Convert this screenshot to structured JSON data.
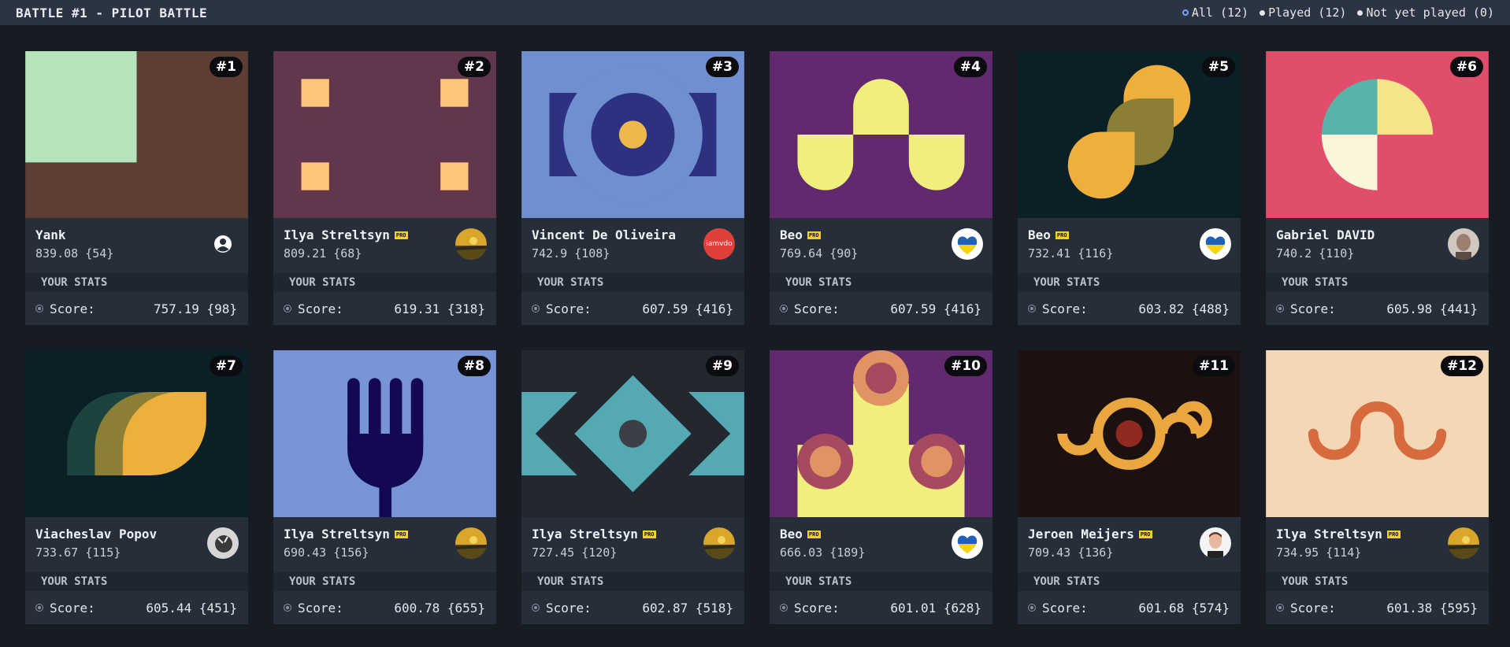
{
  "header": {
    "title": "BATTLE #1 - PILOT BATTLE",
    "filters": [
      {
        "label": "All (12)",
        "active": true
      },
      {
        "label": "Played (12)",
        "active": false
      },
      {
        "label": "Not yet played (0)",
        "active": false
      }
    ]
  },
  "labels": {
    "your_stats": "YOUR STATS",
    "score": "Score:",
    "pro": "PRO"
  },
  "cards": [
    {
      "rank": "#1",
      "author": "Yank",
      "pro": false,
      "rating": "839.08 {54}",
      "your_score": "757.19 {98}",
      "avatar": "user-icon"
    },
    {
      "rank": "#2",
      "author": "Ilya Streltsyn",
      "pro": true,
      "rating": "809.21 {68}",
      "your_score": "619.31 {318}",
      "avatar": "landscape-avatar"
    },
    {
      "rank": "#3",
      "author": "Vincent De Oliveira",
      "pro": false,
      "rating": "742.9 {108}",
      "your_score": "607.59 {416}",
      "avatar": "iamvdo-logo",
      "avatar_text": "iamvdo"
    },
    {
      "rank": "#4",
      "author": "Beo",
      "pro": true,
      "rating": "769.64 {90}",
      "your_score": "607.59 {416}",
      "avatar": "ukraine-heart-avatar"
    },
    {
      "rank": "#5",
      "author": "Beo",
      "pro": true,
      "rating": "732.41 {116}",
      "your_score": "603.82 {488}",
      "avatar": "ukraine-heart-avatar"
    },
    {
      "rank": "#6",
      "author": "Gabriel DAVID",
      "pro": false,
      "rating": "740.2 {110}",
      "your_score": "605.98 {441}",
      "avatar": "photo-avatar"
    },
    {
      "rank": "#7",
      "author": "Viacheslav Popov",
      "pro": false,
      "rating": "733.67 {115}",
      "your_score": "605.44 {451}",
      "avatar": "photo-avatar"
    },
    {
      "rank": "#8",
      "author": "Ilya Streltsyn",
      "pro": true,
      "rating": "690.43 {156}",
      "your_score": "600.78 {655}",
      "avatar": "landscape-avatar"
    },
    {
      "rank": "#9",
      "author": "Ilya Streltsyn",
      "pro": true,
      "rating": "727.45 {120}",
      "your_score": "602.87 {518}",
      "avatar": "landscape-avatar"
    },
    {
      "rank": "#10",
      "author": "Beo",
      "pro": true,
      "rating": "666.03 {189}",
      "your_score": "601.01 {628}",
      "avatar": "ukraine-heart-avatar"
    },
    {
      "rank": "#11",
      "author": "Jeroen Meijers",
      "pro": true,
      "rating": "709.43 {136}",
      "your_score": "601.68 {574}",
      "avatar": "photo-avatar"
    },
    {
      "rank": "#12",
      "author": "Ilya Streltsyn",
      "pro": true,
      "rating": "734.95 {114}",
      "your_score": "601.38 {595}",
      "avatar": "landscape-avatar"
    }
  ],
  "colors": {
    "background": "#161b24",
    "topbar": "#2b3442",
    "card": "#262e3a",
    "pro_badge": "#f2d226",
    "active_radio": "#6ea8fe"
  }
}
